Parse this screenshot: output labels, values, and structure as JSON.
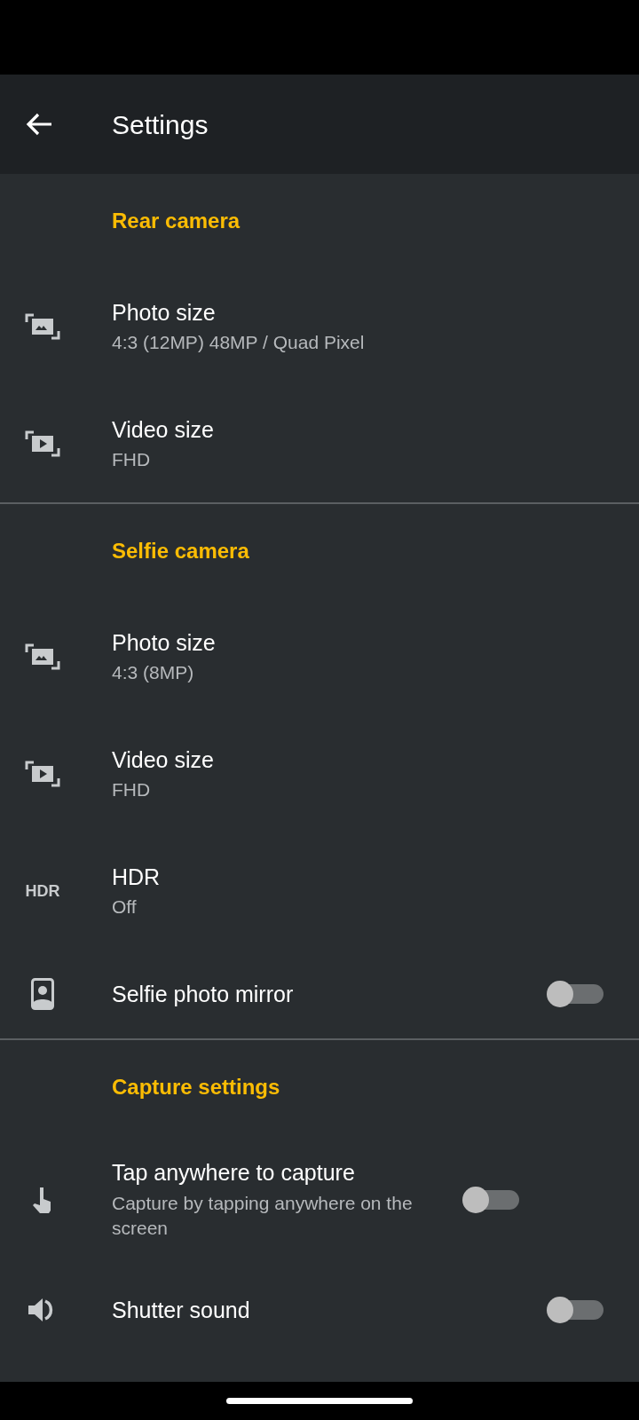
{
  "app_bar": {
    "title": "Settings"
  },
  "sections": [
    {
      "header": "Rear camera",
      "items": [
        {
          "kind": "photo",
          "title": "Photo size",
          "summary": "4:3 (12MP) 48MP / Quad Pixel"
        },
        {
          "kind": "video",
          "title": "Video size",
          "summary": "FHD"
        }
      ]
    },
    {
      "header": "Selfie camera",
      "items": [
        {
          "kind": "photo",
          "title": "Photo size",
          "summary": "4:3 (8MP)"
        },
        {
          "kind": "video",
          "title": "Video size",
          "summary": "FHD"
        },
        {
          "kind": "hdr",
          "icon_text": "HDR",
          "title": "HDR",
          "summary": "Off"
        },
        {
          "kind": "portrait",
          "title": "Selfie photo mirror",
          "on": false
        }
      ]
    },
    {
      "header": "Capture settings",
      "items": [
        {
          "kind": "touch",
          "title": "Tap anywhere to capture",
          "summary": "Capture by tapping anywhere on the screen",
          "on": false
        },
        {
          "kind": "sound",
          "title": "Shutter sound",
          "on": false
        }
      ]
    }
  ]
}
